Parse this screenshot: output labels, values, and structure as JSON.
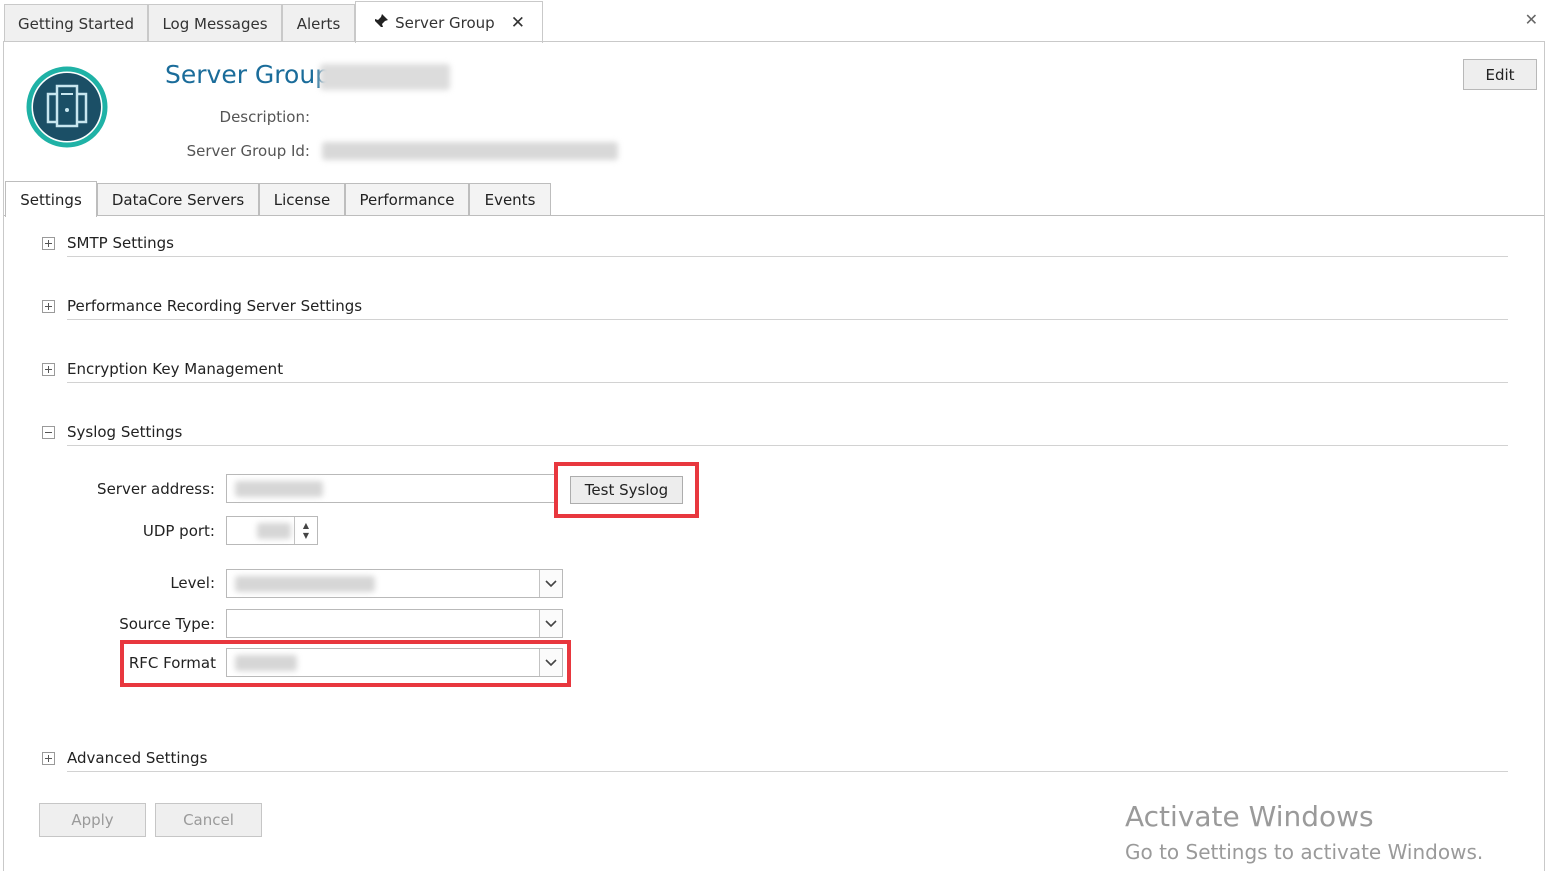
{
  "doc_tabs": {
    "getting_started": "Getting Started",
    "log_messages": "Log Messages",
    "alerts": "Alerts",
    "server_group": "Server Group",
    "pin_icon": "pin-icon",
    "close_glyph": "✕"
  },
  "window_close_glyph": "✕",
  "header": {
    "title": "Server Group",
    "description_label": "Description:",
    "server_group_id_label": "Server Group Id:",
    "edit_label": "Edit",
    "logo_icon": "server-group-icon",
    "accent_color": "#1a6c9a"
  },
  "inner_tabs": {
    "settings": "Settings",
    "datacore_servers": "DataCore Servers",
    "license": "License",
    "performance": "Performance",
    "events": "Events"
  },
  "sections": {
    "smtp": "SMTP Settings",
    "perf_recording": "Performance Recording Server Settings",
    "encryption": "Encryption Key Management",
    "syslog": "Syslog Settings",
    "advanced": "Advanced Settings"
  },
  "syslog": {
    "server_address_label": "Server address:",
    "test_syslog_label": "Test Syslog",
    "udp_port_label": "UDP port:",
    "level_label": "Level:",
    "source_type_label": "Source Type:",
    "rfc_format_label": "RFC Format",
    "dropdown_glyph": "⌄",
    "spin_up": "▲",
    "spin_down": "▼"
  },
  "buttons": {
    "apply": "Apply",
    "cancel": "Cancel"
  },
  "watermark": {
    "line1": "Activate Windows",
    "line2": "Go to Settings to activate Windows."
  },
  "highlight_color": "#e8373e"
}
